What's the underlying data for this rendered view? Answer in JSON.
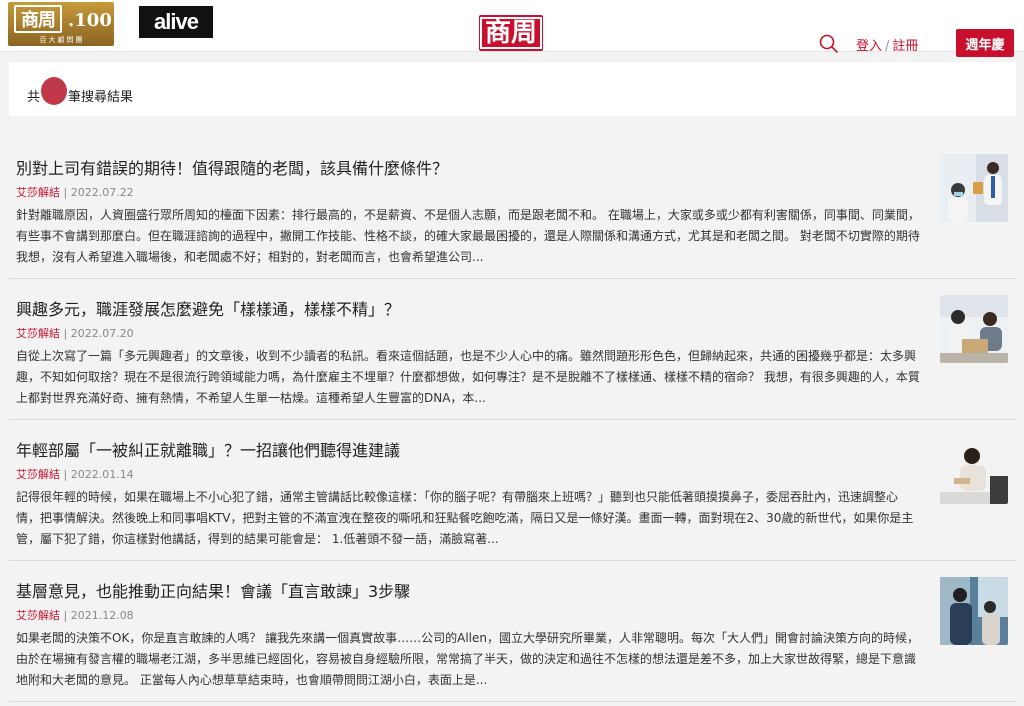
{
  "header": {
    "logo_left": {
      "mark": "商周",
      "suffix": ".100",
      "subtitle": "百大顧問團"
    },
    "logo_alive": "alive",
    "logo_center": "商周",
    "login_label": "登入",
    "divider": "/",
    "register_label": "註冊",
    "anniversary_label": "週年慶"
  },
  "results": {
    "prefix": "共",
    "count": "",
    "suffix": "筆搜尋結果"
  },
  "articles": [
    {
      "title": "別對上司有錯誤的期待！值得跟隨的老闆，該具備什麼條件？",
      "author": "艾莎解結",
      "date": "2022.07.22",
      "excerpt": "針對離職原因，人資圈盛行眾所周知的檯面下因素：排行最高的，不是薪資、不是個人志願，而是跟老闆不和。 在職場上，大家或多或少都有利害關係，同事間、同業間，有些事不會講到那麼白。但在職涯諮詢的過程中，撇開工作技能、性格不談，的確大家最最困擾的，還是人際關係和溝通方式，尤其是和老闆之間。 對老闆不切實際的期待 我想，沒有人希望進入職場後，和老闆處不好；相對的，對老闆而言，也會希望進公司..."
    },
    {
      "title": "興趣多元，職涯發展怎麼避免「樣樣通，樣樣不精」？",
      "author": "艾莎解結",
      "date": "2022.07.20",
      "excerpt": "自從上次寫了一篇「多元興趣者」的文章後，收到不少讀者的私訊。看來這個話題，也是不少人心中的痛。雖然問題形形色色，但歸納起來，共通的困擾幾乎都是：太多興趣，不知如何取捨？現在不是很流行跨領域能力嗎，為什麼雇主不埋單？什麼都想做，如何專注？是不是脫離不了樣樣通、樣樣不精的宿命？ 我想，有很多興趣的人，本質上都對世界充滿好奇、擁有熱情，不希望人生單一枯燥。這種希望人生豐富的DNA，本..."
    },
    {
      "title": "年輕部屬「一被糾正就離職」？一招讓他們聽得進建議",
      "author": "艾莎解結",
      "date": "2022.01.14",
      "excerpt": "記得很年輕的時候，如果在職場上不小心犯了錯，通常主管講話比較像這樣：「你的腦子呢？有帶腦來上班嗎？」聽到也只能低著頭摸摸鼻子，委屈吞肚內，迅速調整心情，把事情解決。然後晚上和同事唱KTV，把對主管的不滿宣洩在整夜的嘶吼和狂點餐吃飽吃滿，隔日又是一條好漢。畫面一轉，面對現在2、30歲的新世代，如果你是主管，屬下犯了錯，你這樣對他講話，得到的結果可能會是： 1.低著頭不發一語，滿臉寫著..."
    },
    {
      "title": "基層意見，也能推動正向結果！會議「直言敢諫」3步驟",
      "author": "艾莎解結",
      "date": "2021.12.08",
      "excerpt": "如果老闆的決策不OK，你是直言敢諫的人嗎？ 讓我先來講一個真實故事……公司的Allen，國立大學研究所畢業，人非常聰明。每次「大人們」開會討論決策方向的時候，由於在場擁有發言權的職場老江湖，多半思維已經固化，容易被自身經驗所限，常常搞了半天，做的決定和過往不怎樣的想法還是差不多，加上大家世故得緊，總是下意識地附和大老闆的意見。 正當每人內心想草草結束時，也會順帶問問江湖小白，表面上是..."
    }
  ],
  "colors": {
    "brand_red": "#c8102e",
    "background": "#f3f3f3"
  }
}
